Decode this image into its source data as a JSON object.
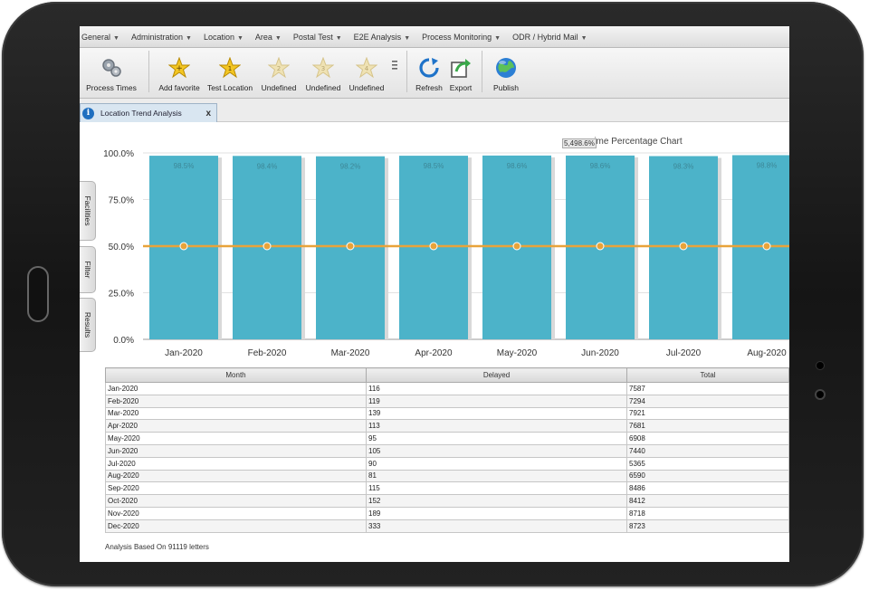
{
  "menu": [
    {
      "label": "General"
    },
    {
      "label": "Administration"
    },
    {
      "label": "Location"
    },
    {
      "label": "Area"
    },
    {
      "label": "Postal Test"
    },
    {
      "label": "E2E Analysis"
    },
    {
      "label": "Process Monitoring"
    },
    {
      "label": "ODR / Hybrid Mail"
    }
  ],
  "toolbar": {
    "process_times": "Process Times",
    "add_favorite": "Add favorite",
    "test_location": "Test Location",
    "undefined": "Undefined",
    "refresh": "Refresh",
    "export": "Export",
    "publish": "Publish"
  },
  "tab": {
    "label": "Location Trend Analysis",
    "close": "x"
  },
  "side_tabs": {
    "facilities": "Facilities",
    "filter": "Filter",
    "results": "Results"
  },
  "colors": {
    "bar": "#4cb3c9",
    "line": "#e8a33a",
    "accent": "#1f6fc0"
  },
  "chart_data": {
    "type": "bar",
    "title": "...ime Percentage Chart",
    "tooltip": "5,498.6%",
    "categories": [
      "Jan-2020",
      "Feb-2020",
      "Mar-2020",
      "Apr-2020",
      "May-2020",
      "Jun-2020",
      "Jul-2020",
      "Aug-2020"
    ],
    "series": [
      {
        "values": [
          98.5,
          98.4,
          98.2,
          98.5,
          98.6,
          98.6,
          98.3,
          98.8
        ],
        "data_labels": [
          "98.5%",
          "98.4%",
          "98.2%",
          "98.5%",
          "98.6%",
          "98.6%",
          "98.3%",
          "98.8%"
        ]
      },
      {
        "type": "line",
        "values": [
          50,
          50,
          50,
          50,
          50,
          50,
          50,
          50
        ]
      }
    ],
    "yticks": [
      "100.0%",
      "75.0%",
      "50.0%",
      "25.0%",
      "0.0%"
    ],
    "ylim": [
      0,
      100
    ]
  },
  "table": {
    "headers": [
      "Month",
      "Delayed",
      "Total"
    ],
    "rows": [
      [
        "Jan-2020",
        "116",
        "7587"
      ],
      [
        "Feb-2020",
        "119",
        "7294"
      ],
      [
        "Mar-2020",
        "139",
        "7921"
      ],
      [
        "Apr-2020",
        "113",
        "7681"
      ],
      [
        "May-2020",
        "95",
        "6908"
      ],
      [
        "Jun-2020",
        "105",
        "7440"
      ],
      [
        "Jul-2020",
        "90",
        "5365"
      ],
      [
        "Aug-2020",
        "81",
        "6590"
      ],
      [
        "Sep-2020",
        "115",
        "8486"
      ],
      [
        "Oct-2020",
        "152",
        "8412"
      ],
      [
        "Nov-2020",
        "189",
        "8718"
      ],
      [
        "Dec-2020",
        "333",
        "8723"
      ]
    ]
  },
  "footer": "Analysis Based On 91119 letters"
}
